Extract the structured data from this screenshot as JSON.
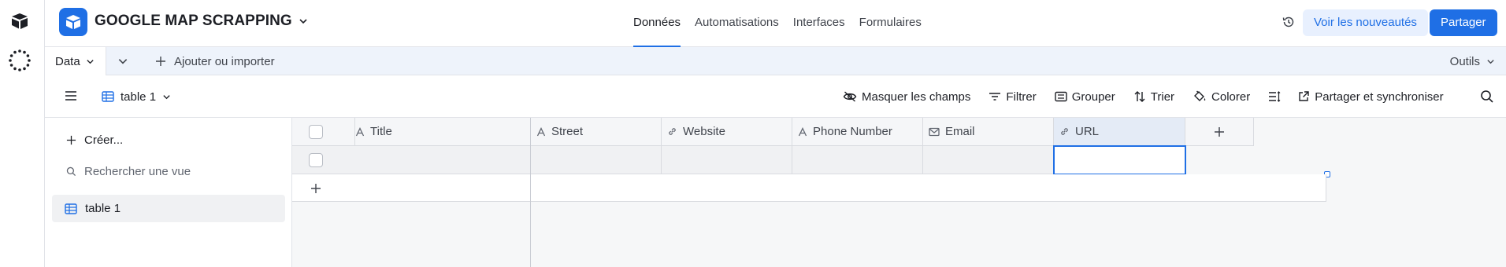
{
  "header": {
    "base_name": "GOOGLE MAP SCRAPPING",
    "tabs": [
      {
        "label": "Données",
        "active": true
      },
      {
        "label": "Automatisations",
        "active": false
      },
      {
        "label": "Interfaces",
        "active": false
      },
      {
        "label": "Formulaires",
        "active": false
      }
    ],
    "whats_new_label": "Voir les nouveautés",
    "share_label": "Partager"
  },
  "tabsbar": {
    "current_table": "Data",
    "add_import_label": "Ajouter ou importer",
    "tools_label": "Outils"
  },
  "viewbar": {
    "view_name": "table 1",
    "actions": {
      "hide_fields": "Masquer les champs",
      "filter": "Filtrer",
      "group": "Grouper",
      "sort": "Trier",
      "color": "Colorer",
      "share_sync": "Partager et synchroniser"
    }
  },
  "sidebar": {
    "create_label": "Créer...",
    "search_placeholder": "Rechercher une vue",
    "views": [
      {
        "label": "table 1",
        "active": true
      }
    ]
  },
  "grid": {
    "columns": [
      {
        "label": "Title",
        "icon": "text-icon"
      },
      {
        "label": "Street",
        "icon": "text-icon"
      },
      {
        "label": "Website",
        "icon": "link-icon"
      },
      {
        "label": "Phone Number",
        "icon": "text-icon"
      },
      {
        "label": "Email",
        "icon": "email-icon"
      },
      {
        "label": "URL",
        "icon": "link-icon"
      }
    ]
  },
  "colors": {
    "accent": "#1f6fe5",
    "accent_light": "#e8f0fe"
  }
}
